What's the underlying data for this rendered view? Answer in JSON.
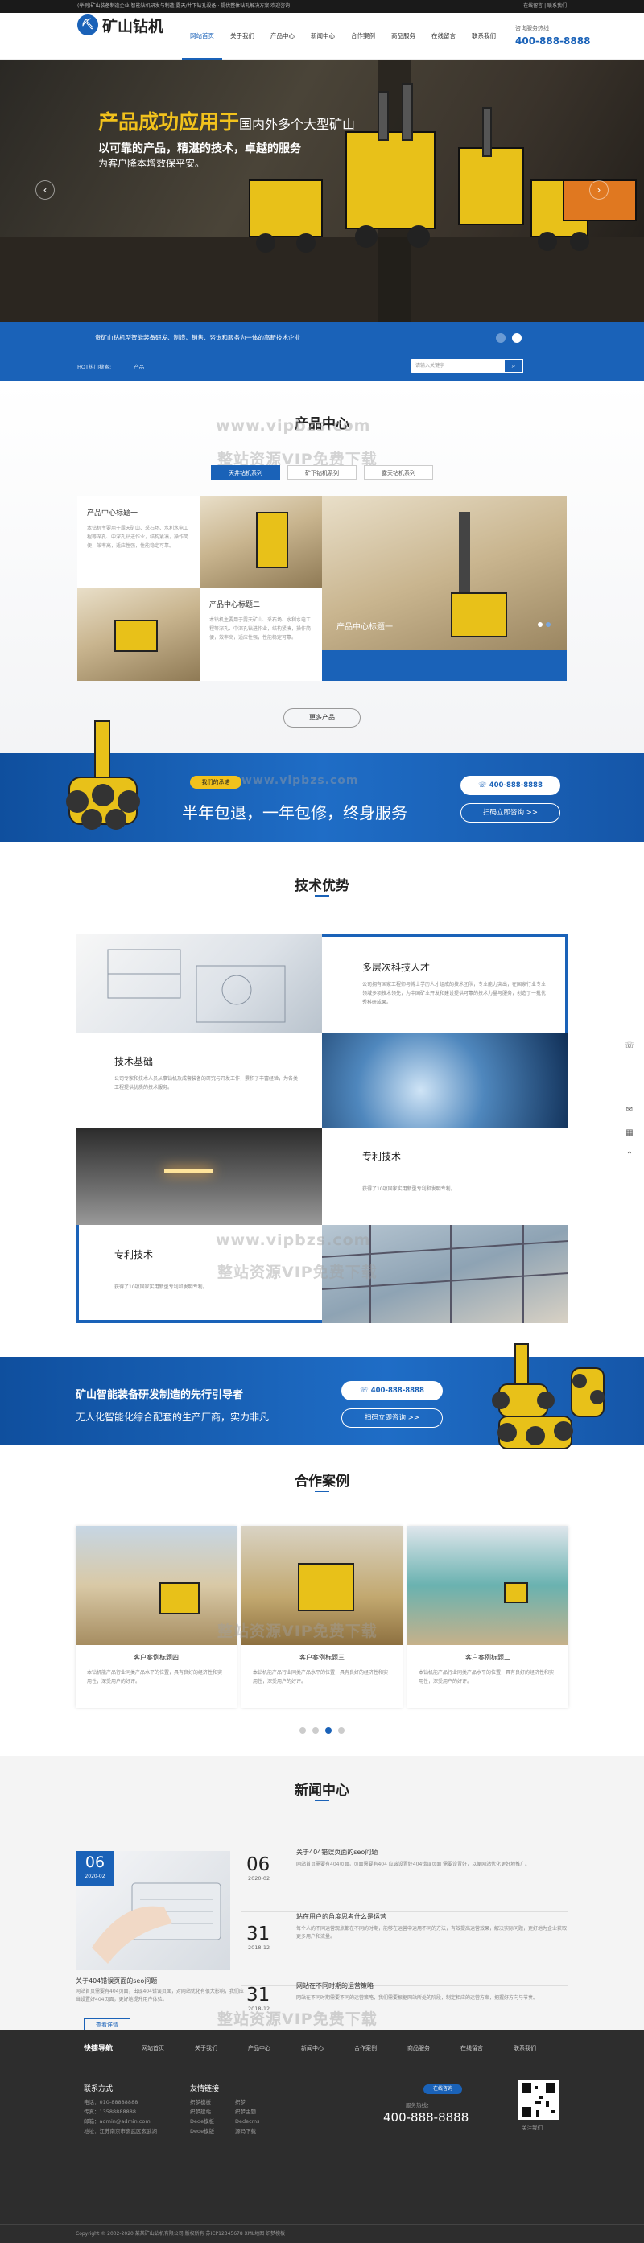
{
  "topbar": {
    "left": "(举例)矿山装备制造企业·智能钻机研发与制造·露天/井下钻孔设备 · 提供整体钻孔解决方案·欢迎咨询",
    "right": "在线留言 | 联系我们"
  },
  "header": {
    "logo_text": "矿山钻机",
    "nav": [
      "网站首页",
      "关于我们",
      "产品中心",
      "新闻中心",
      "合作案例",
      "商品服务",
      "在线留言",
      "联系我们"
    ],
    "hotline_label": "咨询服务热线",
    "hotline": "400-888-8888"
  },
  "banner": {
    "headline_yellow": "产品成功应用于",
    "headline_white": "国内外多个大型矿山",
    "line2": "以可靠的产品，精湛的技术，卓越的服务",
    "line3": "为客户降本增效保平安。",
    "prev": "‹",
    "next": "›"
  },
  "strip": {
    "intro": "贵矿山钻机型智能装备研发、制造、销售、咨询和服务为一体的高新技术企业",
    "hot_label": "HOT热门搜索:",
    "hot_item": "产品",
    "search_placeholder": "请输入关键字",
    "search_icon": "search-icon"
  },
  "products": {
    "title": "产品中心",
    "watermark_url": "www.vipbzs.com",
    "watermark_cn": "整站资源VIP免费下载",
    "tabs": [
      "天井钻机系列",
      "矿下钻机系列",
      "露天钻机系列"
    ],
    "items": [
      {
        "title": "产品中心标题一",
        "text": "本钻机主要用于露天矿山、采石场、水利水电工程等深孔、中深孔钻进作业，结构紧凑，操作简便，效率高，适应性强，性能稳定可靠。"
      },
      {
        "title": "产品中心标题二",
        "text": "本钻机主要用于露天矿山、采石场、水利水电工程等深孔、中深孔钻进作业，结构紧凑，操作简便，效率高，适应性强，性能稳定可靠。"
      },
      {
        "title": "产品中心标题一"
      }
    ],
    "more": "更多产品"
  },
  "promo": {
    "tag": "我们的承诺",
    "text": "半年包退，一年包修，终身服务",
    "phone": "400-888-8888",
    "scan": "扫码立即咨询 >>"
  },
  "tech": {
    "title": "技术优势",
    "items": [
      {
        "title": "多层次科技人才",
        "text": "公司拥有国家工程师与博士学历人才组成的技术团队，专业能力突出，在国家行业专业领域多项技术领先，为中国矿业开发和建设提供可靠的技术力量与服务，创造了一批优秀科研成果。"
      },
      {
        "title": "技术基础",
        "text": "公司专家和技术人员从事钻机及成套装备的研究与开发工作，累积了丰富经验，为各类工程提供优质的技术服务。"
      },
      {
        "title": "专利技术",
        "text": "获得了10项国家实用新型专利和发明专利。"
      },
      {
        "title": "专利技术",
        "text": "获得了10项国家实用新型专利和发明专利。"
      }
    ]
  },
  "promo2": {
    "line1": "矿山智能装备研发制造的先行引导者",
    "line2": "无人化智能化综合配套的生产厂商，实力非凡",
    "phone": "400-888-8888",
    "scan": "扫码立即咨询 >>"
  },
  "cases": {
    "title": "合作案例",
    "items": [
      {
        "title": "客户案例标题四",
        "text": "本钻机能产品行业同类产品水平的位置，具有良好的经济性和实用性，深受用户的好评。"
      },
      {
        "title": "客户案例标题三",
        "text": "本钻机能产品行业同类产品水平的位置，具有良好的经济性和实用性，深受用户的好评。"
      },
      {
        "title": "客户案例标题二",
        "text": "本钻机能产品行业同类产品水平的位置，具有良好的经济性和实用性，深受用户的好评。"
      }
    ]
  },
  "news": {
    "title": "新闻中心",
    "feature": {
      "day": "06",
      "ym": "2020-02",
      "title": "关于404错误页面的seo问题",
      "text": "网站首页需要有404页面，出现404错误页面，对网站优化有很大影响，我们应当设置好404页面，更好地提升用户体验。",
      "btn": "查看详情"
    },
    "list": [
      {
        "day": "06",
        "ym": "2020-02",
        "title": "关于404错误页面的seo问题",
        "text": "网站首页需要有404页面，页面需要有404 应该设置好404错误页面 需要设置好，以便网站优化更好地推广。"
      },
      {
        "day": "31",
        "ym": "2018-12",
        "title": "站在用户的角度思考什么是运营",
        "text": "每个人的不同运营观点都在不同的时期，能够在运营中运用不同的方法，有效提高运营效果，解决实际问题，更好地为企业获取更多用户和流量。"
      },
      {
        "day": "31",
        "ym": "2018-12",
        "title": "网站在不同时期的运营策略",
        "text": "网站在不同时期需要不同的运营策略，我们需要根据网站所处的阶段，制定相应的运营方案，把握好方向与节奏。"
      }
    ]
  },
  "footer": {
    "quick_label": "快捷导航",
    "nav": [
      "网站首页",
      "关于我们",
      "产品中心",
      "新闻中心",
      "合作案例",
      "商品服务",
      "在线留言",
      "联系我们"
    ],
    "contact_title": "联系方式",
    "contact": [
      "电话：010-88888888",
      "传真：13588888888",
      "邮箱：admin@admin.com",
      "地址：江苏南京市玄武区玄武湖"
    ],
    "links_title": "友情链接",
    "links": [
      "织梦模板",
      "织梦",
      "织梦建站",
      "织梦主题",
      "Dede模板",
      "Dedecms",
      "Dede模版",
      "源码下载"
    ],
    "online": "在线咨询",
    "hotline_label": "服务热线：",
    "hotline": "400-888-8888",
    "qr_label": "关注我们",
    "copyright": "Copyright © 2002-2020 某某矿山钻机有限公司 版权所有  苏ICP12345678  XML地图  织梦模板"
  },
  "side": [
    "phone-icon",
    "chat-icon",
    "qr-icon",
    "top-icon"
  ]
}
